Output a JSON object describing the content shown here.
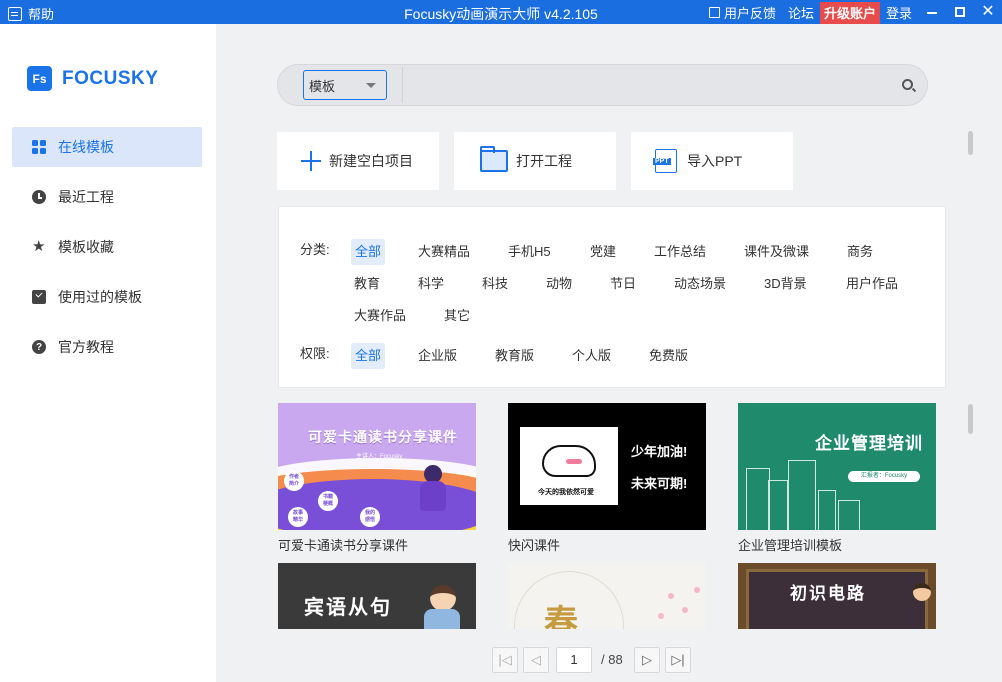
{
  "titlebar": {
    "help_label": "帮助",
    "title": "Focusky动画演示大师 v4.2.105",
    "feedback_label": "用户反馈",
    "forum_label": "论坛",
    "upgrade_label": "升级账户",
    "login_label": "登录",
    "close_glyph": "✕"
  },
  "sidebar": {
    "logo_mark": "Fs",
    "logo_name": "FOCUSKY",
    "items": [
      {
        "label": "在线模板",
        "icon": "grid-icon",
        "active": true
      },
      {
        "label": "最近工程",
        "icon": "clock-icon"
      },
      {
        "label": "模板收藏",
        "icon": "star-icon"
      },
      {
        "label": "使用过的模板",
        "icon": "checklist-icon"
      },
      {
        "label": "官方教程",
        "icon": "question-icon"
      }
    ]
  },
  "search": {
    "select_value": "模板",
    "input_value": ""
  },
  "actions": {
    "new_label": "新建空白项目",
    "open_label": "打开工程",
    "import_label": "导入PPT",
    "ppt_badge": "PPT"
  },
  "filters": {
    "category_label": "分类:",
    "categories": [
      "全部",
      "大赛精品",
      "手机H5",
      "党建",
      "工作总结",
      "课件及微课",
      "商务",
      "教育",
      "科学",
      "科技",
      "动物",
      "节日",
      "动态场景",
      "3D背景",
      "用户作品",
      "大赛作品",
      "其它"
    ],
    "permission_label": "权限:",
    "permissions": [
      "全部",
      "企业版",
      "教育版",
      "个人版",
      "免费版"
    ]
  },
  "templates": [
    {
      "name": "可爱卡通读书分享课件",
      "thumb_title": "可爱卡通读书分享课件",
      "thumb_sub": "主讲人：Focusky",
      "bubbles": [
        "作者\n简介",
        "书籍\n梗概",
        "我的\n感悟",
        "故事\n精华"
      ]
    },
    {
      "name": "快闪课件",
      "thumb_line1": "少年加油!",
      "thumb_line2": "未来可期!",
      "thumb_caption": "今天的我依然可爱"
    },
    {
      "name": "企业管理培训模板",
      "thumb_title": "企业管理培训",
      "thumb_badge": "汇报者：Focusky"
    },
    {
      "name": "",
      "thumb_title": "宾语从句"
    },
    {
      "name": "",
      "thumb_title": "春"
    },
    {
      "name": "",
      "thumb_title": "初识电路"
    }
  ],
  "pager": {
    "first": "|◁",
    "prev": "◁",
    "next": "▷",
    "last": "▷|",
    "current": "1",
    "total": "/ 88"
  },
  "colors": {
    "accent": "#1a73e8",
    "titlebar": "#1b6ee0",
    "upgrade": "#e84b4b"
  }
}
